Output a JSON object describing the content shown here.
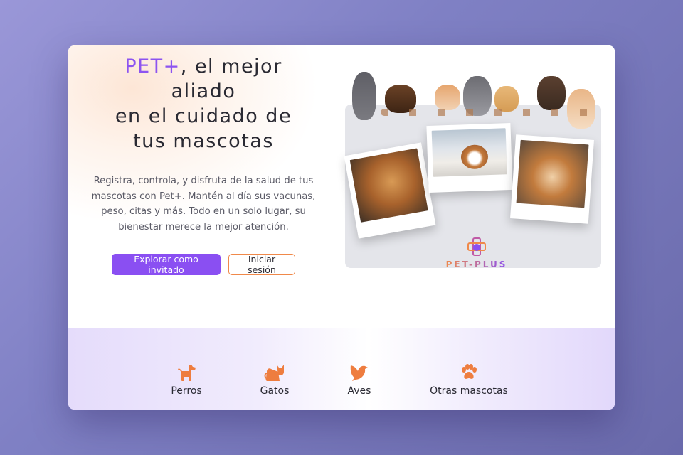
{
  "hero": {
    "headline_brand": "PET+",
    "headline_rest_1": ", el mejor",
    "headline_line_2": "aliado",
    "headline_line_3": "en el cuidado de",
    "headline_line_4": "tus mascotas",
    "description": "Registra, controla, y disfruta de la salud de tus mascotas con Pet+. Mantén al día sus vacunas, peso, citas y más. Todo en un solo lugar, su bienestar merece la mejor atención.",
    "guest_button": "Explorar como invitado",
    "login_button": "Iniciar sesión"
  },
  "illustration": {
    "logo_text": "PET-PLUS"
  },
  "categories": [
    {
      "label": "Perros",
      "icon": "dog-icon"
    },
    {
      "label": "Gatos",
      "icon": "cat-icon"
    },
    {
      "label": "Aves",
      "icon": "bird-icon"
    },
    {
      "label": "Otras mascotas",
      "icon": "paw-icon"
    }
  ],
  "colors": {
    "brand_purple": "#8a4ff2",
    "accent_orange": "#f0894a",
    "background": "#7f80c4"
  }
}
